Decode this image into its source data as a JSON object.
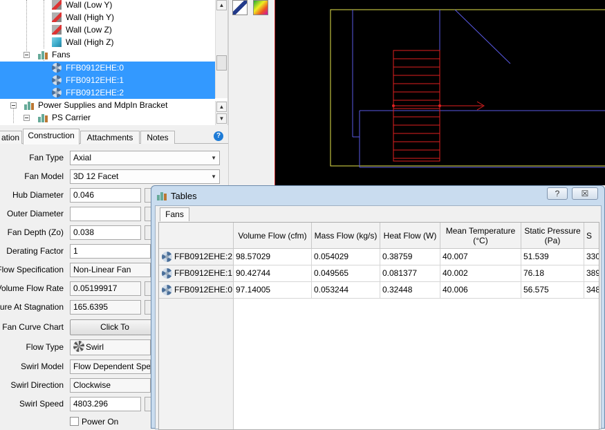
{
  "tree": {
    "items": [
      {
        "label": "Wall (Low Y)",
        "icon": "wall-icon"
      },
      {
        "label": "Wall (High Y)",
        "icon": "wall-icon"
      },
      {
        "label": "Wall (Low Z)",
        "icon": "wall-icon"
      },
      {
        "label": "Wall (High Z)",
        "icon": "wall-icon"
      },
      {
        "label": "Fans",
        "icon": "assembly-icon"
      },
      {
        "label": "FFB0912EHE:0",
        "icon": "fan-icon",
        "selected": true
      },
      {
        "label": "FFB0912EHE:1",
        "icon": "fan-icon",
        "selected": true
      },
      {
        "label": "FFB0912EHE:2",
        "icon": "fan-icon",
        "selected": true
      },
      {
        "label": "Power Supplies and MdpIn Bracket",
        "icon": "assembly-icon"
      },
      {
        "label": "PS Carrier",
        "icon": "assembly-icon"
      }
    ]
  },
  "tabs": [
    "ation",
    "Construction",
    "Attachments",
    "Notes"
  ],
  "properties": {
    "fan_type": {
      "label": "Fan Type",
      "value": "Axial"
    },
    "fan_model": {
      "label": "Fan Model",
      "value": "3D 12 Facet"
    },
    "hub_diameter": {
      "label": "Hub Diameter",
      "value": "0.046"
    },
    "outer_diameter": {
      "label": "Outer Diameter",
      "value": ""
    },
    "fan_depth": {
      "label": "Fan Depth (Zo)",
      "value": "0.038"
    },
    "derating_factor": {
      "label": "Derating Factor",
      "value": "1"
    },
    "flow_specification": {
      "label": "Flow Specification",
      "value": "Non-Linear Fan"
    },
    "volume_flow_rate": {
      "label": "n Volume Flow Rate",
      "value": "0.05199917"
    },
    "pressure_stagnation": {
      "label": "ssure At Stagnation",
      "value": "165.6395"
    },
    "fan_curve_chart": {
      "label": "Fan Curve Chart",
      "value": "Click To"
    },
    "flow_type": {
      "label": "Flow Type",
      "value": "Swirl"
    },
    "swirl_model": {
      "label": "Swirl Model",
      "value": "Flow Dependent Speed"
    },
    "swirl_direction": {
      "label": "Swirl Direction",
      "value": "Clockwise"
    },
    "swirl_speed": {
      "label": "Swirl Speed",
      "value": "4803.296"
    },
    "power_on": {
      "label": "Power On",
      "checked": false
    }
  },
  "dialog": {
    "title": "Tables",
    "help_label": "?",
    "close_label": "☒",
    "tab": "Fans",
    "columns": [
      "Volume Flow (cfm)",
      "Mass Flow (kg/s)",
      "Heat Flow (W)",
      "Mean Temperature (°C)",
      "Static Pressure (Pa)",
      "S"
    ],
    "rows": [
      {
        "name": "FFB0912EHE:2",
        "values": [
          "98.57029",
          "0.054029",
          "0.38759",
          "40.007",
          "51.539",
          "330"
        ]
      },
      {
        "name": "FFB0912EHE:1",
        "values": [
          "90.42744",
          "0.049565",
          "0.081377",
          "40.002",
          "76.18",
          "389"
        ]
      },
      {
        "name": "FFB0912EHE:0",
        "values": [
          "97.14005",
          "0.053244",
          "0.32448",
          "40.006",
          "56.575",
          "348"
        ]
      }
    ]
  },
  "colors": {
    "selection": "#3399ff",
    "viewport_bg": "#000000",
    "outline_yellow": "#e6e64c",
    "outline_blue": "#5a5ae6",
    "fan_red": "#e02020"
  }
}
